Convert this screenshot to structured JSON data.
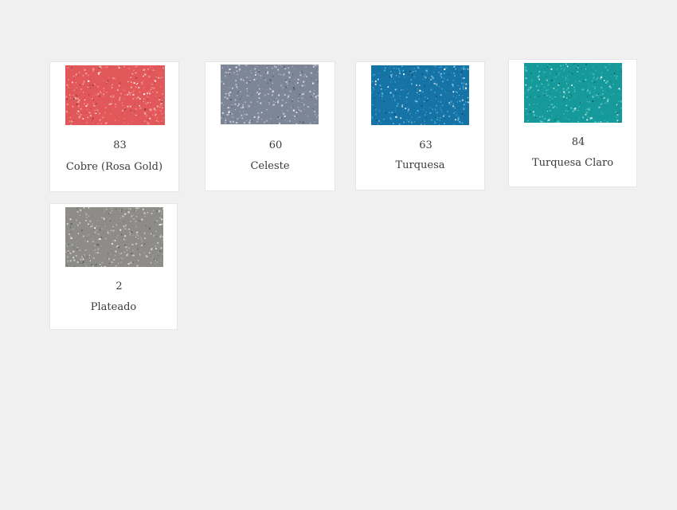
{
  "products": [
    {
      "code": "83",
      "name": "Cobre (Rosa Gold)",
      "color": "#e2585a",
      "sparkle": "#f6b5a8"
    },
    {
      "code": "60",
      "name": "Celeste",
      "color": "#7d8697",
      "sparkle": "#d9dde6"
    },
    {
      "code": "63",
      "name": "Turquesa",
      "color": "#1673a6",
      "sparkle": "#62c3ea"
    },
    {
      "code": "84",
      "name": "Turquesa Claro",
      "color": "#16999a",
      "sparkle": "#63d3cc"
    },
    {
      "code": "2",
      "name": "Plateado",
      "color": "#8d8c88",
      "sparkle": "#e2e1dc"
    }
  ]
}
